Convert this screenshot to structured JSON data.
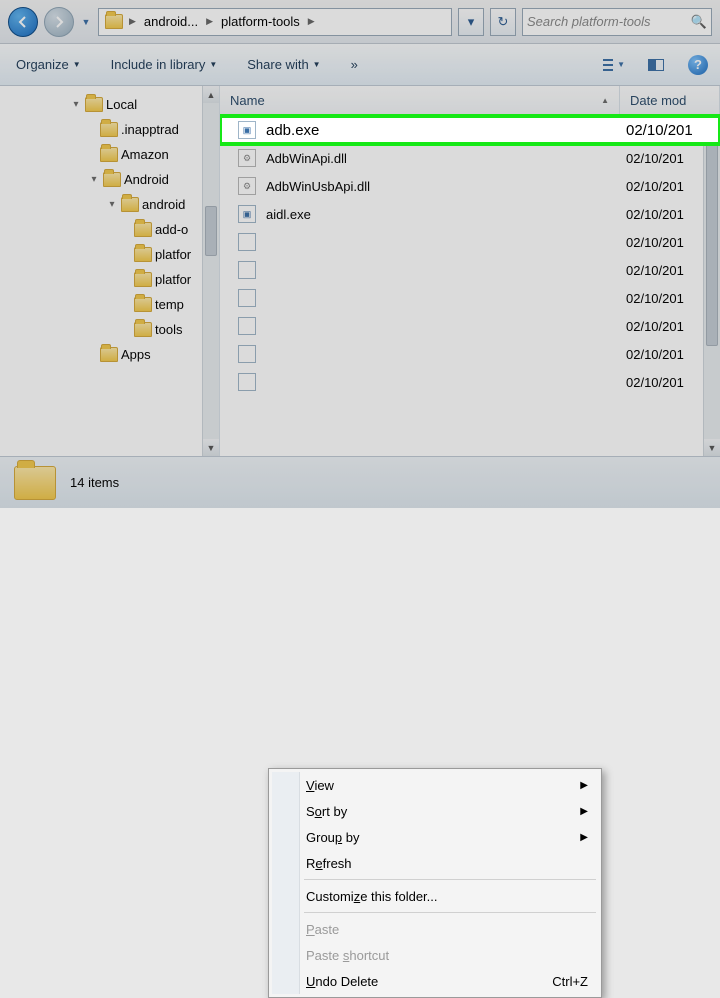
{
  "breadcrumbs": {
    "item0": "android...",
    "item1": "platform-tools"
  },
  "search": {
    "placeholder": "Search platform-tools"
  },
  "toolbar": {
    "organize": "Organize",
    "include": "Include in library",
    "share": "Share with",
    "more": "»"
  },
  "columns": {
    "name": "Name",
    "date": "Date mod"
  },
  "tree": {
    "n0": "Local",
    "n1": ".inapptrad",
    "n2": "Amazon",
    "n3": "Android",
    "n4": "android",
    "n5": "add-o",
    "n6": "platfor",
    "n7": "platfor",
    "n8": "temp",
    "n9": "tools",
    "n10": "Apps"
  },
  "files": {
    "r0": {
      "name": "adb.exe",
      "date": "02/10/201"
    },
    "r1": {
      "name": "AdbWinApi.dll",
      "date": "02/10/201"
    },
    "r2": {
      "name": "AdbWinUsbApi.dll",
      "date": "02/10/201"
    },
    "r3": {
      "name": "aidl.exe",
      "date": "02/10/201"
    },
    "r4": {
      "name": "",
      "date": "02/10/201"
    },
    "r5": {
      "name": "",
      "date": "02/10/201"
    },
    "r6": {
      "name": "",
      "date": "02/10/201"
    },
    "r7": {
      "name": "",
      "date": "02/10/201"
    },
    "r8": {
      "name": "",
      "date": "02/10/201"
    },
    "r9": {
      "name": "",
      "date": "02/10/201"
    }
  },
  "status": {
    "count": "14 items"
  },
  "ctx": {
    "view": "View",
    "sort": "Sort by",
    "group": "Group by",
    "refresh": "Refresh",
    "customize": "Customize this folder...",
    "paste": "Paste",
    "paste_shortcut": "Paste shortcut",
    "undo": "Undo Delete",
    "undo_sc": "Ctrl+Z"
  }
}
